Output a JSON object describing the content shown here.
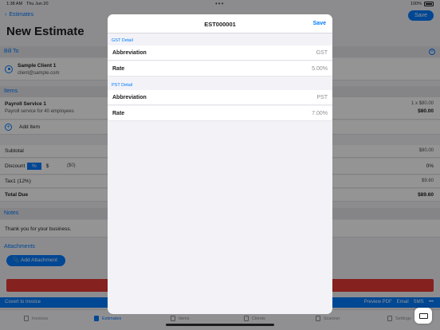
{
  "status_bar": {
    "time": "1:38 AM",
    "date": "Thu Jun 20",
    "battery": "100%"
  },
  "nav": {
    "back_label": "Estimates",
    "save_label": "Save",
    "title": "New Estimate"
  },
  "bill_to": {
    "header": "Bill To",
    "client_name": "Sample Client 1",
    "client_email": "client@sample.com"
  },
  "items": {
    "header": "Items",
    "list": [
      {
        "name": "Payroll Service 1",
        "description": "Payroll service for 40 employees",
        "qty_price": "1 x $80.00",
        "total": "$80.00"
      }
    ],
    "add_label": "Add Item"
  },
  "totals": {
    "subtotal_label": "Subtotal",
    "subtotal_value": "$80.00",
    "discount_label": "Discount",
    "discount_percent": "%",
    "discount_dollar": "$",
    "discount_amount": "($0)",
    "discount_value": "0%",
    "tax_label": "Tax1 (12%)",
    "tax_value": "$9.60",
    "total_label": "Total Due",
    "total_value": "$89.60"
  },
  "notes": {
    "header": "Notes",
    "text": "Thank you for your business."
  },
  "attachments": {
    "header": "Attachments",
    "button_label": "Add Attachment"
  },
  "action_bar": {
    "convert_label": "Covert to Invoice",
    "preview_label": "Preview PDF",
    "email_label": "Email",
    "sms_label": "SMS",
    "more_label": "•••"
  },
  "tabs": [
    {
      "label": "Invoices",
      "icon": "invoice-icon",
      "active": false
    },
    {
      "label": "Estimates",
      "icon": "estimate-icon",
      "active": true
    },
    {
      "label": "Items",
      "icon": "items-icon",
      "active": false
    },
    {
      "label": "Clients",
      "icon": "clients-icon",
      "active": false
    },
    {
      "label": "Scanner",
      "icon": "scanner-icon",
      "active": false
    },
    {
      "label": "Settings",
      "icon": "settings-icon",
      "active": false
    }
  ],
  "modal": {
    "title": "EST000001",
    "save_label": "Save",
    "gst": {
      "header": "GST Detail",
      "abbr_label": "Abbreviation",
      "abbr_value": "GST",
      "rate_label": "Rate",
      "rate_value": "5.00%"
    },
    "pst": {
      "header": "PST Detail",
      "abbr_label": "Abbreviation",
      "abbr_value": "PST",
      "rate_label": "Rate",
      "rate_value": "7.00%"
    }
  },
  "colors": {
    "accent": "#007aff",
    "danger": "#e53935"
  }
}
